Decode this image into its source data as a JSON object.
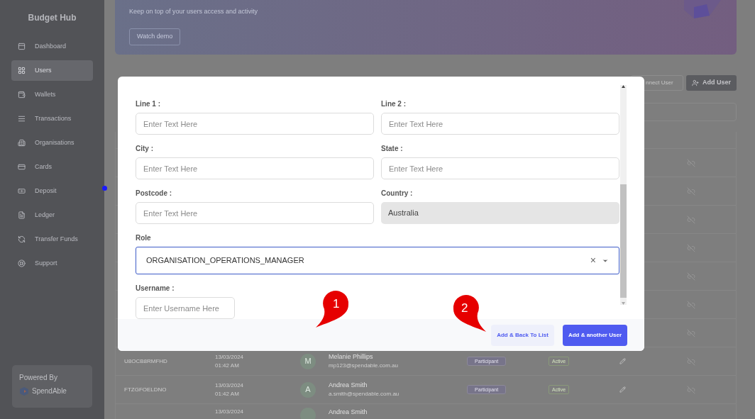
{
  "sidebar": {
    "title": "Budget Hub",
    "items": [
      {
        "label": "Dashboard",
        "selected": false
      },
      {
        "label": "Users",
        "selected": true
      },
      {
        "label": "Wallets",
        "selected": false
      },
      {
        "label": "Transactions",
        "selected": false
      },
      {
        "label": "Organisations",
        "selected": false
      },
      {
        "label": "Cards",
        "selected": false
      },
      {
        "label": "Deposit",
        "selected": false
      },
      {
        "label": "Ledger",
        "selected": false
      },
      {
        "label": "Transfer Funds",
        "selected": false
      },
      {
        "label": "Support",
        "selected": false
      }
    ],
    "powered": {
      "label": "Powered By",
      "brand": "SpendAble"
    }
  },
  "banner": {
    "subtitle": "Keep on top of your users access and activity",
    "button": "Watch demo"
  },
  "actions": {
    "connect": "nnect User",
    "add": "Add User"
  },
  "table": {
    "rows": [
      {
        "kind": "covered"
      },
      {
        "kind": "covered"
      },
      {
        "kind": "covered"
      },
      {
        "kind": "covered"
      },
      {
        "kind": "covered"
      },
      {
        "kind": "covered"
      },
      {
        "kind": "covered"
      },
      {
        "kind": "full",
        "id": "U8OCB8RMFHD",
        "date": "13/03/2024",
        "time": "01:42 AM",
        "avatar": "M",
        "name": "Melanie Phillips",
        "email": "mp123@spendable.com.au",
        "role": "Participant",
        "status": "Active"
      },
      {
        "kind": "full",
        "id": "FTZGFOELDNO",
        "date": "13/03/2024",
        "time": "01:42 AM",
        "avatar": "A",
        "name": "Andrea Smith",
        "email": "a.smith@spendable.com.au",
        "role": "Participant",
        "status": "Active"
      },
      {
        "kind": "partial",
        "date": "13/03/2024",
        "name": "Andrea Smith"
      }
    ]
  },
  "modal": {
    "fields": [
      {
        "kind": "text",
        "label": "Line 1 :",
        "placeholder": "Enter Text Here"
      },
      {
        "kind": "text",
        "label": "Line 2 :",
        "placeholder": "Enter Text Here"
      },
      {
        "kind": "text",
        "label": "City :",
        "placeholder": "Enter Text Here"
      },
      {
        "kind": "text",
        "label": "State :",
        "placeholder": "Enter Text Here"
      },
      {
        "kind": "text",
        "label": "Postcode :",
        "placeholder": "Enter Text Here"
      },
      {
        "kind": "disabled",
        "label": "Country :",
        "value": "Australia"
      },
      {
        "kind": "select",
        "label": "Role",
        "value": "ORGANISATION_OPERATIONS_MANAGER",
        "clear": "×"
      },
      {
        "kind": "short",
        "label": "Username :",
        "placeholder": "Enter Username Here"
      }
    ],
    "buttons": [
      {
        "label": "Add & Back To List",
        "kind": "secondary"
      },
      {
        "label": "Add & another User",
        "kind": "primary"
      }
    ]
  },
  "callouts": [
    "1",
    "2"
  ]
}
